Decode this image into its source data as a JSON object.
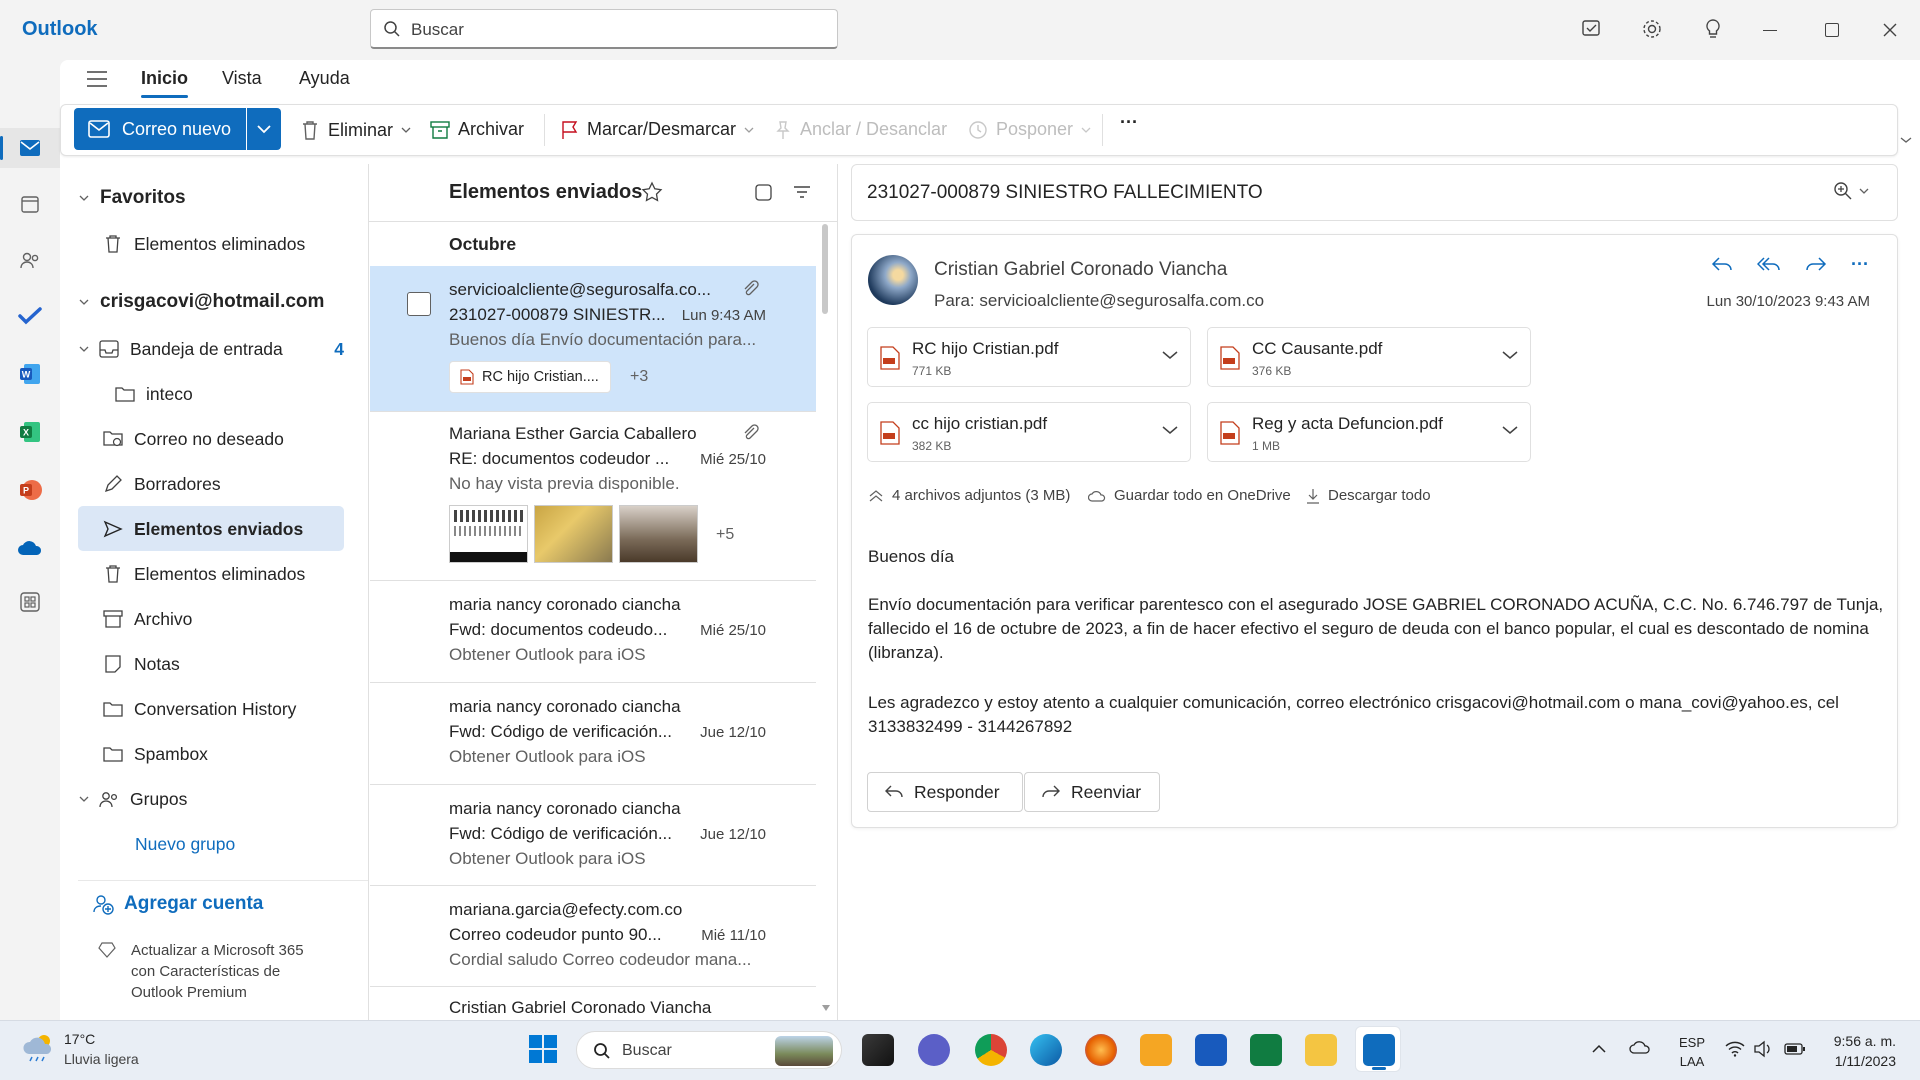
{
  "app": {
    "title": "Outlook"
  },
  "search": {
    "placeholder": "Buscar"
  },
  "ribbon": {
    "tabs": [
      "Inicio",
      "Vista",
      "Ayuda"
    ],
    "new_mail": "Correo nuevo",
    "delete": "Eliminar",
    "archive": "Archivar",
    "flag": "Marcar/Desmarcar",
    "pin": "Anclar / Desanclar",
    "snooze": "Posponer",
    "more": "···"
  },
  "folders": {
    "favorites_header": "Favoritos",
    "fav_deleted": "Elementos eliminados",
    "account": "crisgacovi@hotmail.com",
    "inbox": "Bandeja de entrada",
    "inbox_count": "4",
    "inteco": "inteco",
    "junk": "Correo no deseado",
    "drafts": "Borradores",
    "sent": "Elementos enviados",
    "deleted": "Elementos eliminados",
    "archive": "Archivo",
    "notes": "Notas",
    "conversation_history": "Conversation History",
    "spambox": "Spambox",
    "groups": "Grupos",
    "new_group": "Nuevo grupo",
    "add_account": "Agregar cuenta",
    "upgrade": "Actualizar a Microsoft 365 con Características de Outlook Premium"
  },
  "message_list": {
    "title": "Elementos enviados",
    "month": "Octubre",
    "messages": [
      {
        "from": "servicioalcliente@segurosalfa.co...",
        "subject": "231027-000879 SINIESTR...",
        "date": "Lun 9:43 AM",
        "preview": "Buenos día Envío documentación para...",
        "attachment_chip": "RC hijo Cristian....",
        "attachment_more": "+3"
      },
      {
        "from": "Mariana Esther Garcia Caballero",
        "subject": "RE: documentos codeudor ...",
        "date": "Mié 25/10",
        "preview": "No hay vista previa disponible.",
        "attachment_more": "+5"
      },
      {
        "from": "maria nancy coronado ciancha",
        "subject": "Fwd: documentos codeudo...",
        "date": "Mié 25/10",
        "preview": "Obtener Outlook para iOS"
      },
      {
        "from": "maria nancy coronado ciancha",
        "subject": "Fwd: Código de verificación...",
        "date": "Jue 12/10",
        "preview": "Obtener Outlook para iOS"
      },
      {
        "from": "maria nancy coronado ciancha",
        "subject": "Fwd: Código de verificación...",
        "date": "Jue 12/10",
        "preview": "Obtener Outlook para iOS"
      },
      {
        "from": "mariana.garcia@efecty.com.co",
        "subject": "Correo codeudor punto 90...",
        "date": "Mié 11/10",
        "preview": "Cordial saludo Correo codeudor mana..."
      },
      {
        "from": "Cristian Gabriel Coronado Viancha"
      }
    ]
  },
  "reading": {
    "subject": "231027-000879 SINIESTRO FALLECIMIENTO",
    "sender": "Cristian Gabriel Coronado Viancha",
    "to_label": "Para:",
    "to": "servicioalcliente@segurosalfa.com.co",
    "date": "Lun 30/10/2023 9:43 AM",
    "attachments": [
      {
        "name": "RC hijo Cristian.pdf",
        "size": "771 KB"
      },
      {
        "name": "CC Causante.pdf",
        "size": "376 KB"
      },
      {
        "name": "cc hijo cristian.pdf",
        "size": "382 KB"
      },
      {
        "name": "Reg y acta Defuncion.pdf",
        "size": "1 MB"
      }
    ],
    "attach_summary": "4 archivos adjuntos (3 MB)",
    "save_onedrive": "Guardar todo en OneDrive",
    "download_all": "Descargar todo",
    "greeting": "Buenos día",
    "para1": "Envío documentación para verificar parentesco con el asegurado JOSE GABRIEL CORONADO ACUÑA, C.C. No. 6.746.797 de Tunja, fallecido el 16 de octubre de 2023, a fin de hacer efectivo el seguro de deuda con el banco popular, el cual es descontado de nomina (libranza).",
    "para2": "Les agradezco y estoy atento a cualquier comunicación, correo electrónico crisgacovi@hotmail.com o mana_covi@yahoo.es, cel 3133832499 - 3144267892",
    "reply": "Responder",
    "forward": "Reenviar"
  },
  "taskbar": {
    "temp": "17°C",
    "weather": "Lluvia ligera",
    "search": "Buscar",
    "lang1": "ESP",
    "lang2": "LAA",
    "time": "9:56 a. m.",
    "date": "1/11/2023"
  },
  "colors": {
    "accent": "#0f6cbd",
    "selected": "#cfe4fa"
  }
}
